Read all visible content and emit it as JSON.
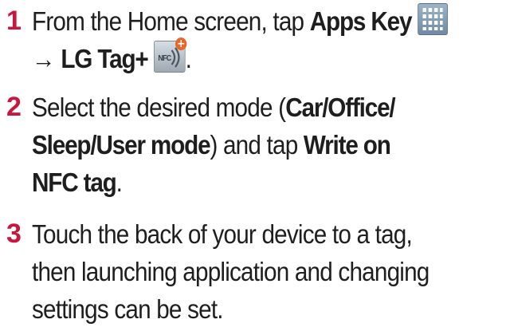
{
  "steps": [
    {
      "number": "1",
      "parts": {
        "t1": "From the Home screen, tap ",
        "b1": "Apps Key",
        "arrow": "→ ",
        "b2": "LG Tag+",
        "end": "."
      }
    },
    {
      "number": "2",
      "parts": {
        "t1": "Select the desired mode (",
        "b1": "Car/Office/",
        "b1b": "Sleep/User mode",
        "t2": ") and tap ",
        "b2": "Write on",
        "b2b": "NFC tag",
        "end": "."
      }
    },
    {
      "number": "3",
      "lines": [
        "Touch the back of your device to a tag,",
        "then launching application and changing",
        "settings can be set."
      ]
    }
  ],
  "icons": {
    "apps": "apps-grid-icon",
    "lg_tag_plus": "nfc-tag-icon",
    "nfc_label": "NFC"
  },
  "colors": {
    "step_number": "#c8163c",
    "text": "#1e1e1e"
  }
}
